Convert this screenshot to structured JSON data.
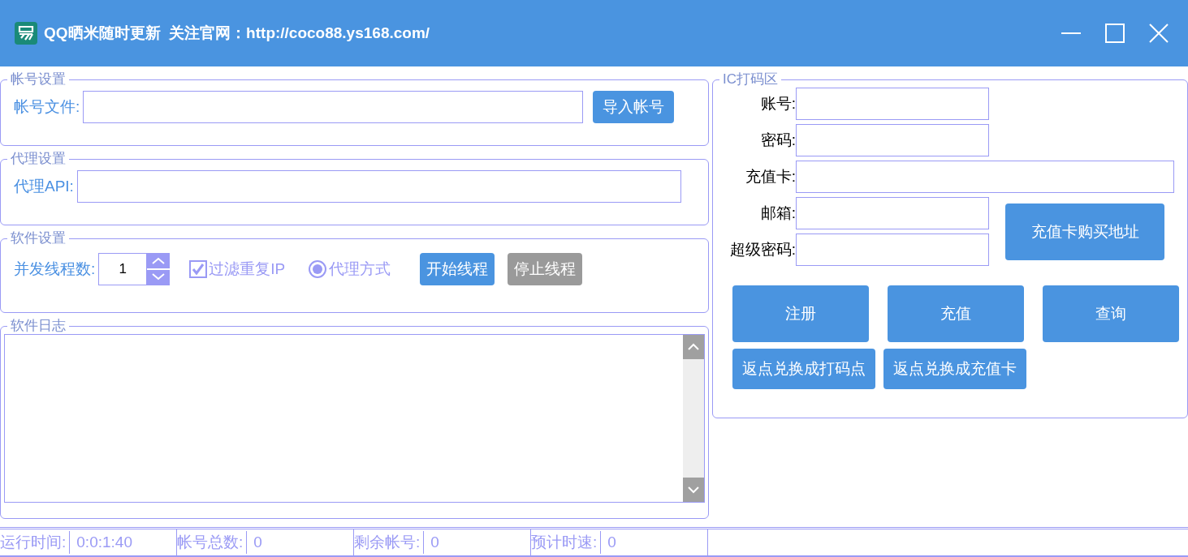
{
  "window": {
    "title": "QQ晒米随时更新  关注官网：http://coco88.ys168.com/"
  },
  "account_settings": {
    "legend": "帐号设置",
    "label": "帐号文件:",
    "button": "导入帐号"
  },
  "proxy_settings": {
    "legend": "代理设置",
    "label": "代理API:"
  },
  "software_settings": {
    "legend": "软件设置",
    "threads_label": "并发线程数:",
    "threads_value": "1",
    "checkbox": {
      "label": "过滤重复IP",
      "checked": true
    },
    "radio": {
      "label": "代理方式",
      "selected": true
    },
    "buttons": [
      {
        "label": "开始线程",
        "disabled": false
      },
      {
        "label": "停止线程",
        "disabled": true
      }
    ]
  },
  "log": {
    "legend": "软件日志"
  },
  "ic_panel": {
    "legend": "IC打码区",
    "fields": [
      {
        "label": "账号:",
        "wide": false
      },
      {
        "label": "密码:",
        "wide": false
      },
      {
        "label": "充值卡:",
        "wide": true
      },
      {
        "label": "邮箱:",
        "wide": false
      },
      {
        "label": "超级密码:",
        "wide": false
      }
    ],
    "buy_button": "充值卡购买地址",
    "actions": [
      "注册",
      "充值",
      "查询"
    ],
    "exchange_buttons": [
      "返点兑换成打码点",
      "返点兑换成充值卡"
    ]
  },
  "status_bar": [
    {
      "label": "运行时间:",
      "value": "0:0:1:40"
    },
    {
      "label": "帐号总数:",
      "value": "0"
    },
    {
      "label": "剩余帐号:",
      "value": "0"
    },
    {
      "label": "预计时速:",
      "value": "0"
    }
  ]
}
